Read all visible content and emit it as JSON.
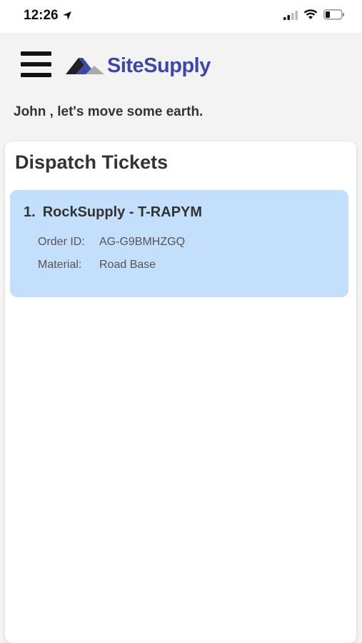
{
  "status_bar": {
    "time": "12:26"
  },
  "header": {
    "brand": "SiteSupply"
  },
  "greeting": "John , let's move some earth.",
  "dispatch": {
    "title": "Dispatch Tickets",
    "tickets": [
      {
        "number": "1.",
        "title": "RockSupply - T-RAPYM",
        "order_label": "Order ID:",
        "order_value": "AG-G9BMHZGQ",
        "material_label": "Material:",
        "material_value": "Road Base"
      }
    ]
  },
  "colors": {
    "brand": "#3d47a8",
    "ticket_bg": "#c3dffb",
    "page_bg": "#f3f3f3"
  }
}
